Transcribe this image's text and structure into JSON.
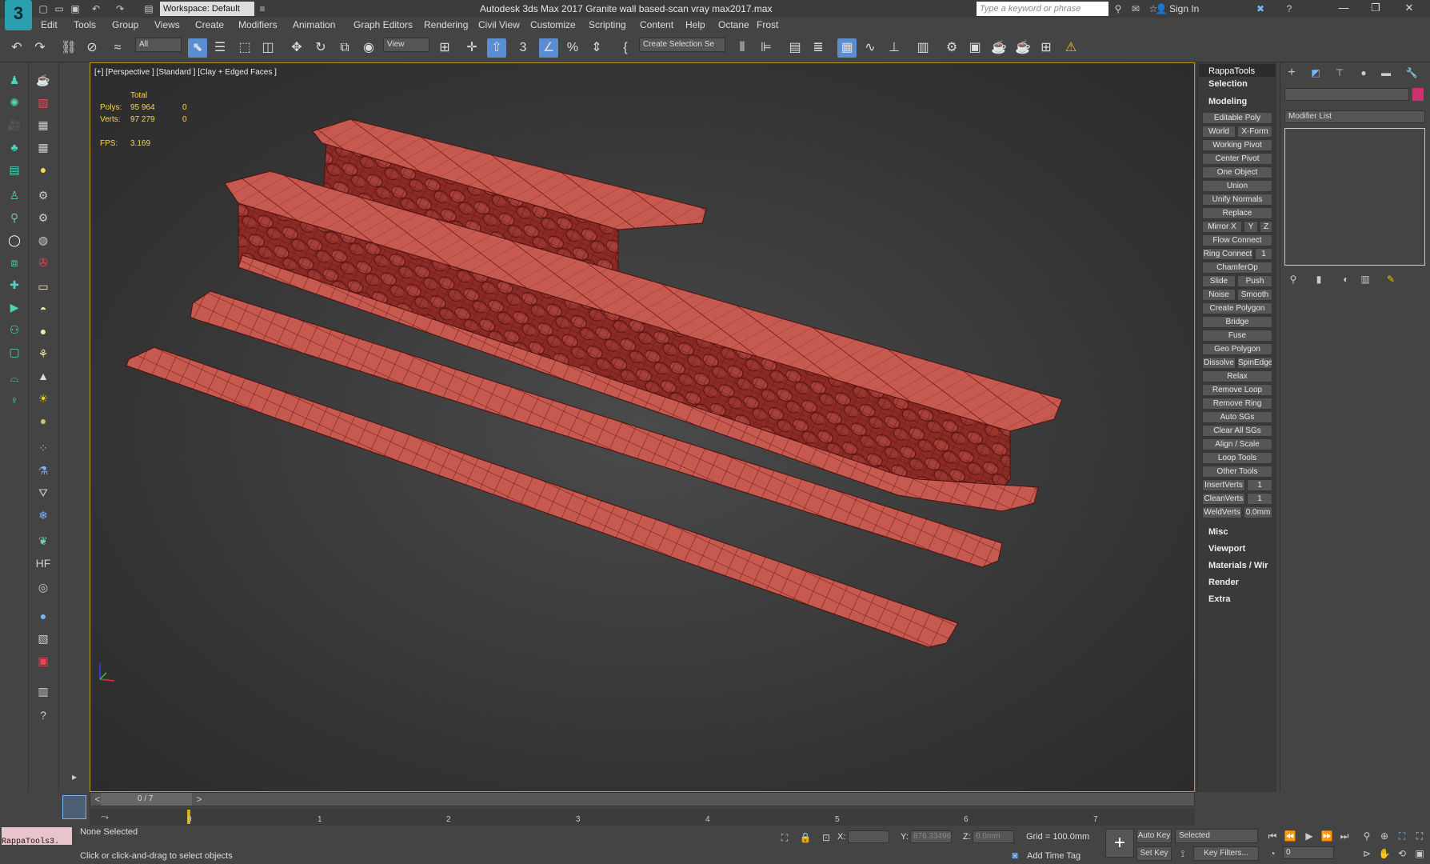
{
  "window": {
    "title": "Autodesk 3ds Max 2017    Granite wall based-scan vray max2017.max",
    "workspace_label": "Workspace: Default",
    "search_placeholder": "Type a keyword or phrase",
    "signin_label": "Sign In",
    "app_logo": "3"
  },
  "menu": [
    "Edit",
    "Tools",
    "Group",
    "Views",
    "Create",
    "Modifiers",
    "Animation",
    "Graph Editors",
    "Rendering",
    "Civil View",
    "Customize",
    "Scripting",
    "Content",
    "Help",
    "Octane",
    "Frost"
  ],
  "toolbar": {
    "selection_filter": "All",
    "ref_coord": "View",
    "selection_set": "Create Selection Se",
    "icons": [
      "undo-icon",
      "redo-icon",
      "link-icon",
      "unlink-icon",
      "bind-spacewarp-icon",
      "select-object-icon",
      "select-by-name-icon",
      "rect-region-icon",
      "window-crossing-icon",
      "move-icon",
      "rotate-icon",
      "scale-icon",
      "place-icon",
      "pivot-icon",
      "snap-toggle-icon",
      "angle-snap-icon",
      "percent-snap-icon",
      "spinner-snap-icon",
      "edit-named-sel-icon",
      "mirror-icon",
      "align-icon",
      "layer-explorer-icon",
      "toggle-ribbon-icon",
      "curve-editor-icon",
      "schematic-icon",
      "material-editor-icon",
      "render-setup-icon",
      "rendered-frame-icon",
      "render-icon",
      "render-active-icon",
      "vray-icon",
      "warning-icon"
    ]
  },
  "viewport": {
    "label": "[+] [Perspective ] [Standard ] [Clay + Edged Faces ]",
    "stats": {
      "total_label": "Total",
      "polys_label": "Polys:",
      "polys_total": "95 964",
      "polys_sel": "0",
      "verts_label": "Verts:",
      "verts_total": "97 279",
      "verts_sel": "0",
      "fps_label": "FPS:",
      "fps_value": "3.169"
    },
    "mesh_color": "#c4524a",
    "mesh_dark": "#7a1d1a",
    "border_color": "#b99c1c"
  },
  "rappatools": {
    "title": "RappaTools",
    "sections": [
      "Selection",
      "Modeling",
      "Misc",
      "Viewport",
      "Materials / Wir",
      "Render",
      "Extra"
    ],
    "buttons": {
      "editable_poly": "Editable Poly",
      "world": "World",
      "xform": "X-Form",
      "working_pivot": "Working Pivot",
      "center_pivot": "Center Pivot",
      "one_object": "One Object",
      "union": "Union",
      "unify_normals": "Unify Normals",
      "replace": "Replace",
      "mirror_x": "Mirror X",
      "y": "Y",
      "z": "Z",
      "flow_connect": "Flow Connect",
      "ring_connect": "Ring Connect",
      "ring_val": "1",
      "chamferop": "ChamferOp",
      "slide": "Slide",
      "push": "Push",
      "noise": "Noise",
      "smooth": "Smooth",
      "create_polygon": "Create Polygon",
      "bridge": "Bridge",
      "fuse": "Fuse",
      "geo_polygon": "Geo Polygon",
      "dissolve": "Dissolve",
      "spinedge": "SpinEdge",
      "relax": "Relax",
      "remove_loop": "Remove Loop",
      "remove_ring": "Remove Ring",
      "auto_sgs": "Auto SGs",
      "clear_all_sgs": "Clear All SGs",
      "align_scale": "Align / Scale",
      "loop_tools": "Loop Tools",
      "other_tools": "Other Tools",
      "insertverts": "InsertVerts",
      "insert_val": "1",
      "cleanverts": "CleanVerts",
      "clean_val": "1",
      "weldverts": "WeldVerts",
      "weld_val": "0.0mm"
    }
  },
  "command_panel": {
    "modifier_list": "Modifier List",
    "swatch_color": "#d0306e"
  },
  "timeline": {
    "frame_label": "0 / 7",
    "ticks": [
      "0",
      "1",
      "2",
      "3",
      "4",
      "5",
      "6",
      "7"
    ]
  },
  "status": {
    "selection": "None Selected",
    "prompt": "Click or click-and-drag to select objects",
    "listener": "RappaTools3.",
    "x_label": "X:",
    "y_label": "Y:",
    "y_value": "876.33496",
    "z_label": "Z:",
    "z_value": "0.0mm",
    "grid": "Grid = 100.0mm",
    "add_time_tag": "Add Time Tag",
    "auto_key": "Auto Key",
    "set_key": "Set Key",
    "selected": "Selected",
    "key_filters": "Key Filters...",
    "frame_value": "0"
  }
}
